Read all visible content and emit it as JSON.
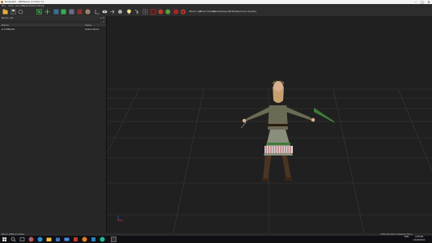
{
  "window": {
    "title": "Noesis64 - [NifSkope 2.0 Dev 7]",
    "controls": [
      "–",
      "□",
      "✕"
    ]
  },
  "menu": [
    "File",
    "View",
    "Render",
    "Spells",
    "Options",
    "Help"
  ],
  "toolbar": {
    "labels": [
      "Block List",
      "Block Details",
      "Header",
      "Inspect",
      "KFM",
      "Reference Header"
    ]
  },
  "block_list": {
    "title": "Block List",
    "filter_label": "⌕",
    "columns": [
      "Name",
      "Value"
    ],
    "rows": [
      {
        "name": "▸ 0 NiNode",
        "value": "Scene Root"
      }
    ]
  },
  "status": {
    "left": "Block List",
    "left2": "Block Details",
    "right": "(0 Blocks) Block Selected: None"
  },
  "taskbar": {
    "time": "3:58 PM",
    "date": "10/26/2021",
    "lang": "ENG"
  },
  "colors": {
    "accent_red": "#c0392b",
    "accent_green": "#4caf50",
    "viewport_bg": "#202020",
    "grid_line": "#3a3a3a"
  }
}
